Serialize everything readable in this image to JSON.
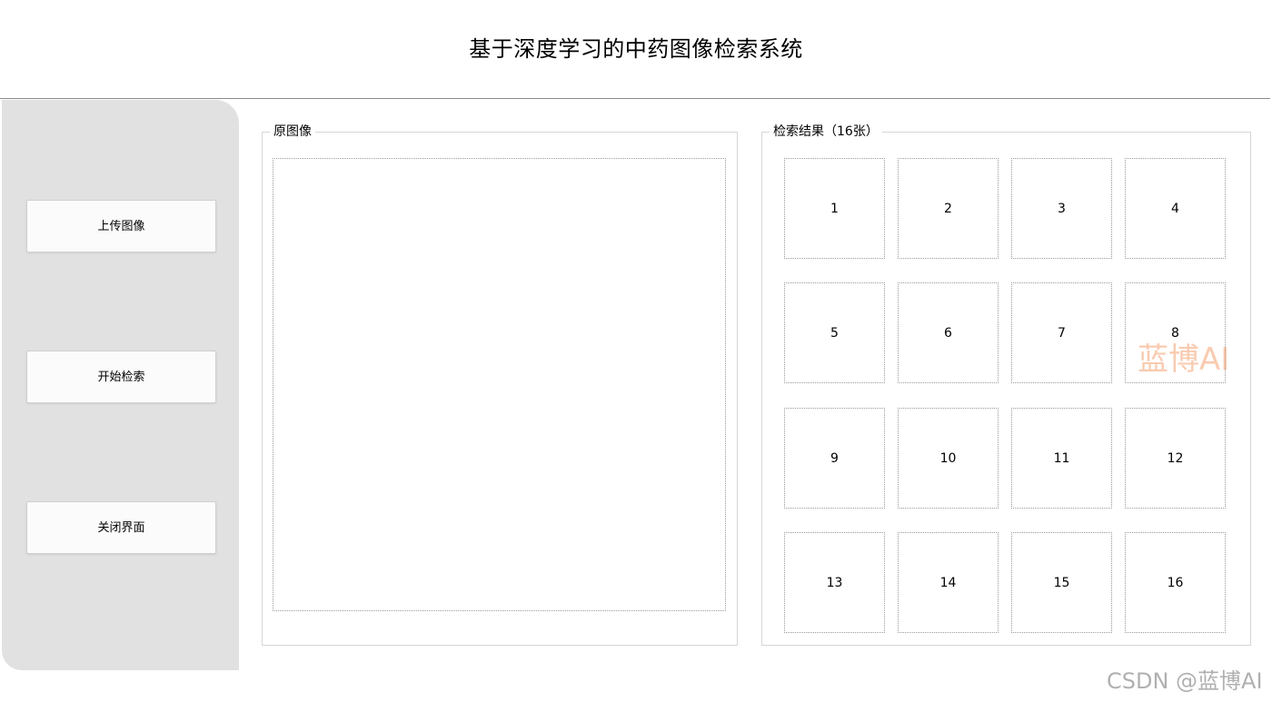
{
  "header": {
    "title": "基于深度学习的中药图像检索系统"
  },
  "sidebar": {
    "buttons": [
      {
        "label": "上传图像"
      },
      {
        "label": "开始检索"
      },
      {
        "label": "关闭界面"
      }
    ]
  },
  "original_panel": {
    "label": "原图像"
  },
  "results_panel": {
    "label": "检索结果（16张）",
    "thumbnails": [
      "1",
      "2",
      "3",
      "4",
      "5",
      "6",
      "7",
      "8",
      "9",
      "10",
      "11",
      "12",
      "13",
      "14",
      "15",
      "16"
    ]
  },
  "watermarks": {
    "center": "蓝博AI",
    "corner": "CSDN @蓝博AI"
  },
  "colors": {
    "sidebar_bg": "#e1e1e1",
    "button_bg": "#fbfbfb",
    "watermark_accent": "#f28c50"
  }
}
